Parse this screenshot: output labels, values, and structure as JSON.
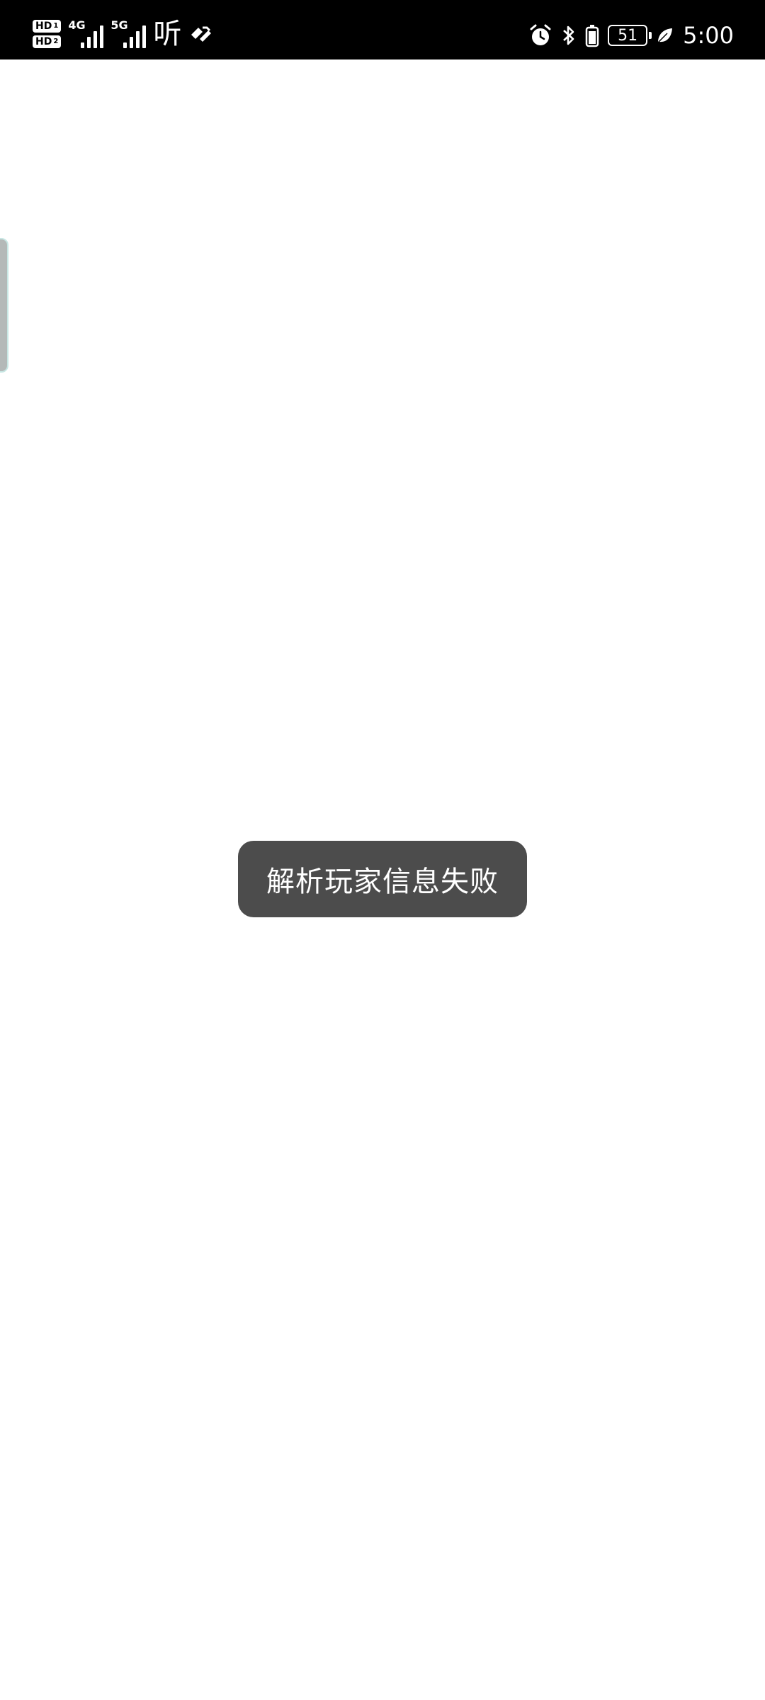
{
  "status_bar": {
    "sim1_label": "HD",
    "sim1_index": "1",
    "sim2_label": "HD",
    "sim2_index": "2",
    "network1": "4G",
    "network2": "5G",
    "extra_icon_text": "听",
    "battery_percent": "51",
    "time": "5:00",
    "icons": [
      "alarm-icon",
      "bluetooth-icon",
      "battery-saver-icon",
      "battery-icon",
      "leaf-icon"
    ],
    "background_color": "#000000",
    "text_color": "#ffffff"
  },
  "toast": {
    "message": "解析玩家信息失败",
    "background_color": "#4c4c4c"
  },
  "page": {
    "background_color": "#ffffff"
  }
}
